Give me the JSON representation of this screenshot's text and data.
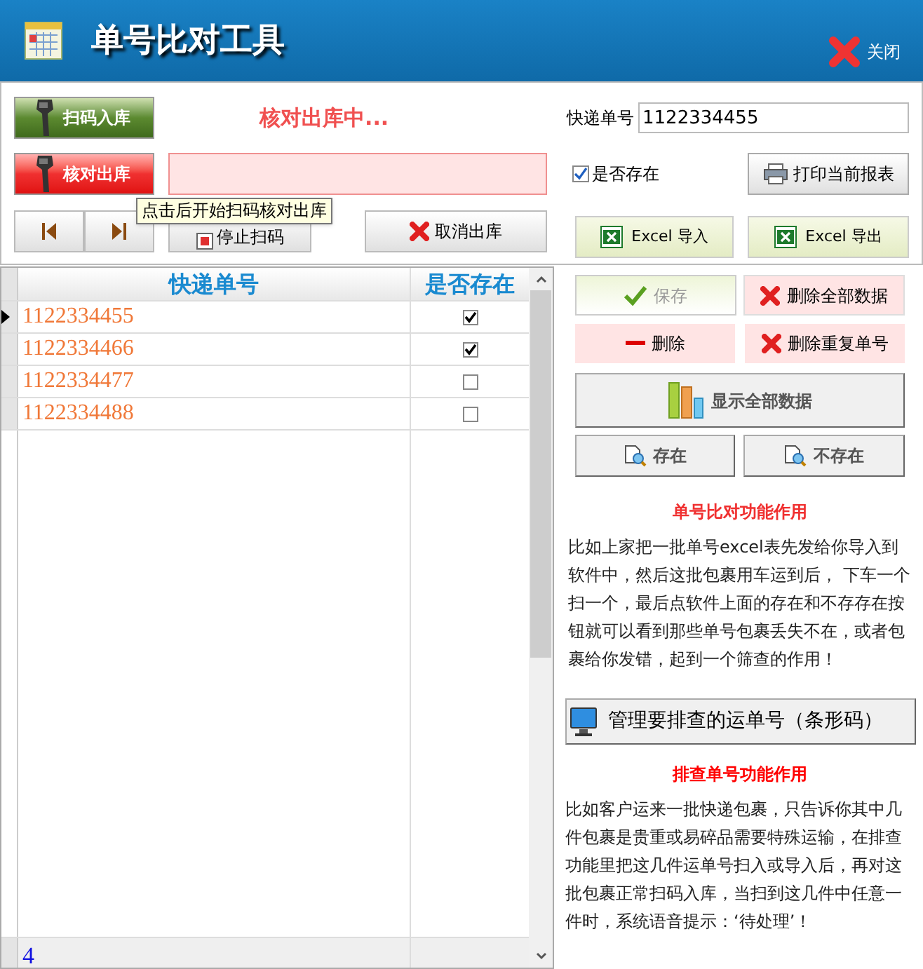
{
  "window": {
    "title": "单号比对工具",
    "close_label": "关闭"
  },
  "toolbar": {
    "scan_in_button": "扫码入库",
    "status": "核对出库中...",
    "tracking_label": "快递单号",
    "tracking_value": "1122334455",
    "check_out_button": "核对出库",
    "exists_checkbox": {
      "label": "是否存在",
      "checked": true
    },
    "print_button": "打印当前报表",
    "stop_button": "停止扫码",
    "cancel_button": "取消出库",
    "import_button": "Excel 导入",
    "export_button": "Excel 导出",
    "tooltip": "点击后开始扫码核对出库"
  },
  "table": {
    "columns": [
      "快递单号",
      "是否存在"
    ],
    "rows": [
      {
        "number": "1122334455",
        "exists": true,
        "selected": true
      },
      {
        "number": "1122334466",
        "exists": true,
        "selected": false
      },
      {
        "number": "1122334477",
        "exists": false,
        "selected": false
      },
      {
        "number": "1122334488",
        "exists": false,
        "selected": false
      }
    ],
    "footer_count": "4"
  },
  "actions": [
    {
      "label": "保存",
      "kind": "save",
      "disabled": true
    },
    {
      "label": "删除全部数据",
      "kind": "delete-all",
      "disabled": false
    },
    {
      "label": "删除",
      "kind": "delete",
      "disabled": false
    },
    {
      "label": "删除重复单号",
      "kind": "delete-duplicates",
      "disabled": false
    },
    {
      "label": "显示全部数据",
      "kind": "show-all",
      "disabled": false
    },
    {
      "label": "存在",
      "kind": "exists",
      "disabled": false
    },
    {
      "label": "不存在",
      "kind": "not-exists",
      "disabled": false
    }
  ],
  "compare_note": {
    "title": "单号比对功能作用",
    "text": "比如上家把一批单号excel表先发给你导入到软件中，然后这批包裹用车运到后， 下车一个扫一个，最后点软件上面的存在和不存存在按钮就可以看到那些单号包裹丢失不在，或者包裹给你发错，起到一个筛查的作用！"
  },
  "manage_button": "管理要排查的运单号（条形码）",
  "check_note": {
    "title": "排查单号功能作用",
    "text": "比如客户运来一批快递包裹，只告诉你其中几件包裹是贵重或易碎品需要特殊运输，在排查功能里把这几件运单号扫入或导入后，再对这批包裹正常扫码入库，当扫到这几件中任意一件时，系统语音提示：‘待处理’！"
  }
}
